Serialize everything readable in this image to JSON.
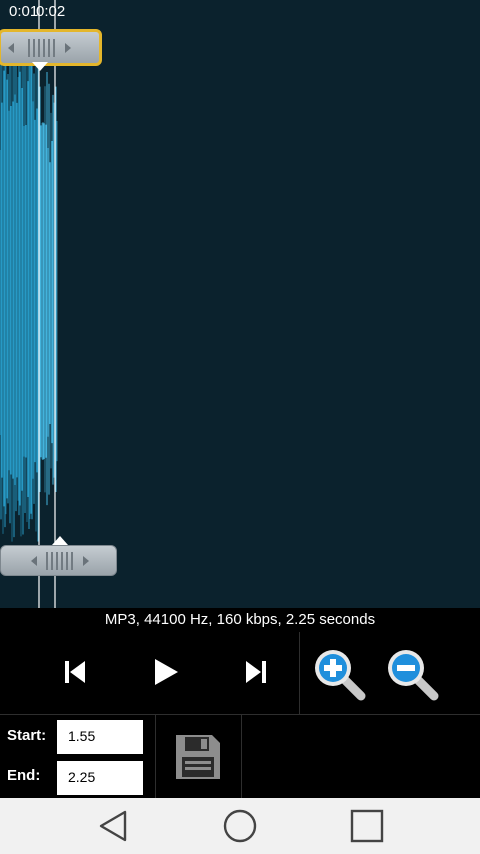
{
  "editor": {
    "timecodes": [
      "0:01",
      "0:02"
    ],
    "colors": {
      "background": "#0b222d",
      "waveform": "#2aa6d6",
      "waveform_peak": "#49c3f0",
      "selection_border": "#e4b62b"
    }
  },
  "info": {
    "text": "MP3, 44100 Hz, 160 kbps, 2.25 seconds"
  },
  "controls": {
    "icons": [
      "skip-previous-icon",
      "play-icon",
      "skip-next-icon",
      "zoom-in-icon",
      "zoom-out-icon"
    ]
  },
  "selection": {
    "start_label": "Start:",
    "start_value": "1.55",
    "end_label": "End:",
    "end_value": "2.25"
  },
  "save": {
    "icon": "floppy-disk-icon"
  },
  "navbar": {
    "icons": [
      "back-icon",
      "home-icon",
      "recents-icon"
    ]
  }
}
